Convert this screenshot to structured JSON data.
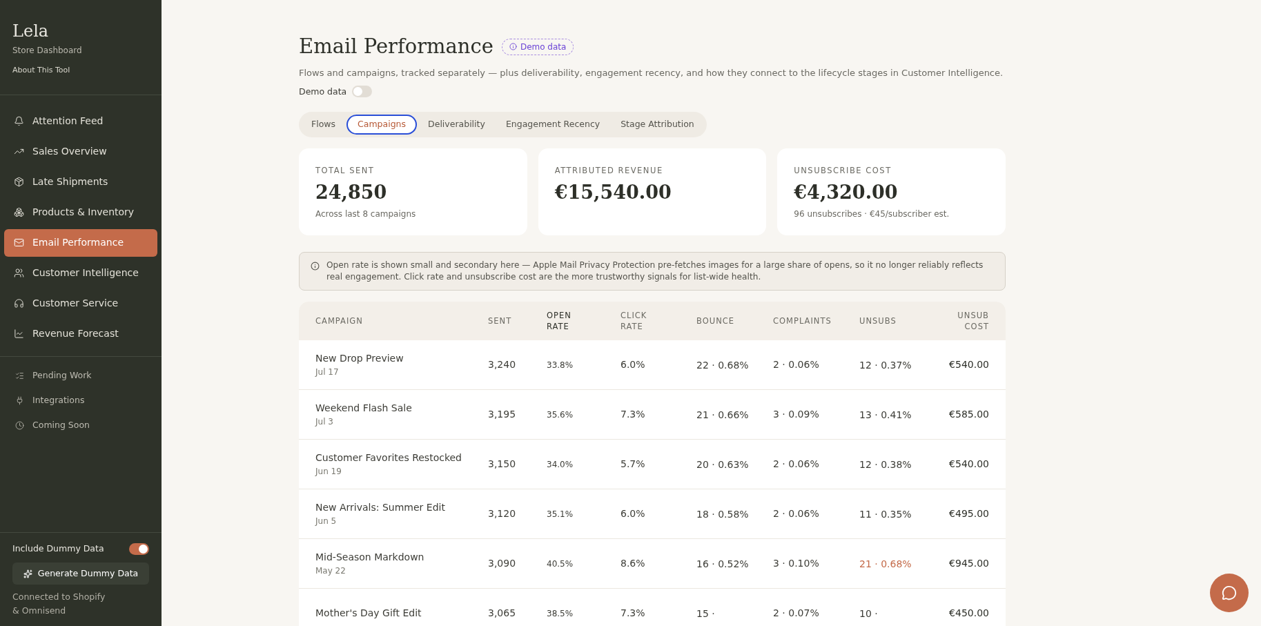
{
  "sidebar": {
    "brand": "Lela",
    "subtitle": "Store Dashboard",
    "about_link": "About This Tool",
    "nav": [
      {
        "label": "Attention Feed",
        "selected": false
      },
      {
        "label": "Sales Overview",
        "selected": false
      },
      {
        "label": "Late Shipments",
        "selected": false
      },
      {
        "label": "Products & Inventory",
        "selected": false
      },
      {
        "label": "Email Performance",
        "selected": true
      },
      {
        "label": "Customer Intelligence",
        "selected": false
      },
      {
        "label": "Customer Service",
        "selected": false
      },
      {
        "label": "Revenue Forecast",
        "selected": false
      }
    ],
    "secondary": [
      {
        "label": "Pending Work"
      },
      {
        "label": "Integrations"
      },
      {
        "label": "Coming Soon"
      }
    ],
    "dummy_toggle": {
      "label": "Include Dummy Data",
      "on": true
    },
    "generate_button": "Generate Dummy Data",
    "connection": "Connected to Shopify & Omnisend"
  },
  "header": {
    "title": "Email Performance",
    "badge": "Demo data",
    "description": "Flows and campaigns, tracked separately — plus deliverability, engagement recency, and how they connect to the lifecycle stages in Customer Intelligence.",
    "demo_toggle": {
      "label": "Demo data",
      "on": false
    }
  },
  "tabs": [
    {
      "label": "Flows",
      "selected": false
    },
    {
      "label": "Campaigns",
      "selected": true
    },
    {
      "label": "Deliverability",
      "selected": false
    },
    {
      "label": "Engagement Recency",
      "selected": false
    },
    {
      "label": "Stage Attribution",
      "selected": false
    }
  ],
  "stats": [
    {
      "label": "TOTAL SENT",
      "value": "24,850",
      "note": "Across last 8 campaigns"
    },
    {
      "label": "ATTRIBUTED REVENUE",
      "value": "€15,540.00"
    },
    {
      "label": "UNSUBSCRIBE COST",
      "value": "€4,320.00",
      "note": "96 unsubscribes · €45/subscriber est."
    }
  ],
  "notice": "Open rate is shown small and secondary here — Apple Mail Privacy Protection pre-fetches images for a large share of opens, so it no longer reliably reflects real engagement. Click rate and unsubscribe cost are the more trustworthy signals for list-wide health.",
  "table": {
    "columns": [
      "CAMPAIGN",
      "SENT",
      "OPEN RATE",
      "CLICK RATE",
      "BOUNCE",
      "COMPLAINTS",
      "UNSUBS",
      "UNSUB COST"
    ],
    "rows": [
      {
        "name": "New Drop Preview",
        "date": "Jul 17",
        "sent": "3,240",
        "open": "33.8%",
        "click": "6.0%",
        "bounce": "22 · 0.68%",
        "complaints": "2 · 0.06%",
        "unsubs": "12 · 0.37%",
        "unsubs_flagged": false,
        "cost": "€540.00"
      },
      {
        "name": "Weekend Flash Sale",
        "date": "Jul 3",
        "sent": "3,195",
        "open": "35.6%",
        "click": "7.3%",
        "bounce": "21 · 0.66%",
        "complaints": "3 · 0.09%",
        "unsubs": "13 · 0.41%",
        "unsubs_flagged": false,
        "cost": "€585.00"
      },
      {
        "name": "Customer Favorites Restocked",
        "date": "Jun 19",
        "sent": "3,150",
        "open": "34.0%",
        "click": "5.7%",
        "bounce": "20 · 0.63%",
        "complaints": "2 · 0.06%",
        "unsubs": "12 · 0.38%",
        "unsubs_flagged": false,
        "cost": "€540.00"
      },
      {
        "name": "New Arrivals: Summer Edit",
        "date": "Jun 5",
        "sent": "3,120",
        "open": "35.1%",
        "click": "6.0%",
        "bounce": "18 · 0.58%",
        "complaints": "2 · 0.06%",
        "unsubs": "11 · 0.35%",
        "unsubs_flagged": false,
        "cost": "€495.00"
      },
      {
        "name": "Mid-Season Markdown",
        "date": "May 22",
        "sent": "3,090",
        "open": "40.5%",
        "click": "8.6%",
        "bounce": "16 · 0.52%",
        "complaints": "3 · 0.10%",
        "unsubs": "21 · 0.68%",
        "unsubs_flagged": true,
        "cost": "€945.00"
      },
      {
        "name": "Mother's Day Gift Edit",
        "sent": "3,065",
        "open": "38.5%",
        "click": "7.3%",
        "bounce": "15 ·",
        "complaints": "2 · 0.07%",
        "unsubs": "10 ·",
        "unsubs_flagged": false,
        "cost": "€450.00"
      }
    ]
  }
}
